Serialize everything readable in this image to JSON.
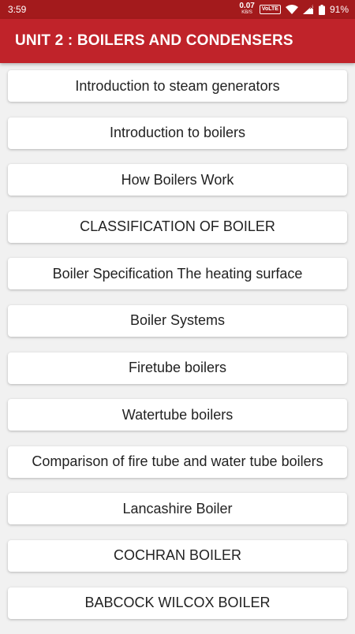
{
  "status_bar": {
    "time": "3:59",
    "net_speed": "0.07",
    "net_unit": "KB/S",
    "volte": "VoLTE",
    "battery": "91%"
  },
  "app_bar": {
    "title": "UNIT 2 : BOILERS AND CONDENSERS"
  },
  "items": [
    {
      "label": "Introduction to steam generators"
    },
    {
      "label": "Introduction to boilers"
    },
    {
      "label": "How Boilers Work"
    },
    {
      "label": "CLASSIFICATION OF BOILER"
    },
    {
      "label": "Boiler Specification The heating surface"
    },
    {
      "label": "Boiler Systems"
    },
    {
      "label": "Firetube boilers"
    },
    {
      "label": "Watertube boilers"
    },
    {
      "label": "Comparison of fire tube and water tube boilers"
    },
    {
      "label": "Lancashire Boiler"
    },
    {
      "label": "COCHRAN BOILER"
    },
    {
      "label": "BABCOCK WILCOX BOILER"
    }
  ],
  "colors": {
    "status_bar": "#a31a1c",
    "app_bar": "#c0232a",
    "background": "#f1f1f1",
    "card": "#ffffff"
  }
}
